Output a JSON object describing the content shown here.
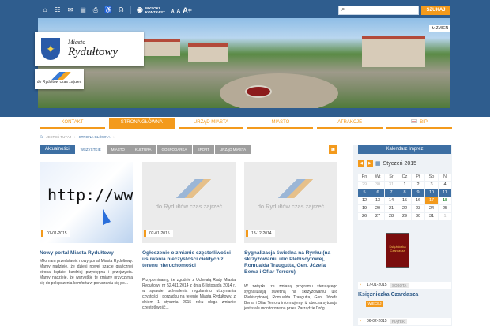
{
  "accessibility": {
    "contrast_line1": "WYSOKI",
    "contrast_line2": "KONTRAST",
    "font_small": "A",
    "font_medium": "A",
    "font_large": "A+"
  },
  "search": {
    "placeholder": "",
    "button": "SZUKAJ"
  },
  "header": {
    "change_label": "ZMIEŃ",
    "logo_top": "Miasto",
    "logo_name": "Rydułtowy",
    "badge_text": "do Rydułtów czas zajrzeć"
  },
  "nav": [
    "KONTAKT",
    "STRONA GŁÓWNA",
    "URZĄD MIASTA",
    "MIASTO",
    "ATRAKCJE",
    "BIP"
  ],
  "breadcrumb": {
    "label": "JESTEŚ TUTAJ",
    "current": "STRONA GŁÓWNA"
  },
  "news": {
    "tab_main": "Aktualności",
    "tabs": [
      "WSZYSTKIE",
      "MIASTO",
      "KULTURA",
      "GOSPODARKA",
      "SPORT",
      "URZĄD MIASTA"
    ],
    "items": [
      {
        "date": "01-01-2015",
        "image_text": "http://www.",
        "title": "Nowy portal Miasta Rydułtowy",
        "body": "Miło nam przedstawić nowy portal Miasta Rydułtowy. Mamy nadzieję, że dzięki nowej szacie graficznej strona będzie bardziej przystępna i przejrzysta. Mamy nadzieję, że wszystkie te zmiany przyczynią się do polepszenia komfortu w poruszaniu się po..."
      },
      {
        "date": "02-01-2015",
        "image_text": "do Rydułtów czas zajrzeć",
        "title": "Ogłoszenie o zmianie częstotliwości usuwania nieczystości ciekłych z terenu nieruchomości",
        "body": "Przypominamy, że zgodnie z Uchwałą Rady Miasta Rydułtowy nr 52.411.2014 z dnia 6 listopada 2014 r. w sprawie uchwalenia regulaminu utrzymania czystości i porządku na terenie Miasta Rydułtowy, z dniem 1 stycznia 2015 roku ulega zmianie częstotliwość..."
      },
      {
        "date": "18-12-2014",
        "image_text": "do Rydułtów czas zajrzeć",
        "title": "Sygnalizacja świetlna na Rynku (na skrzyżowaniu ulic Plebiscytowej, Romualda Traugutta, Gen. Józefa Bema i Ofiar Terroru)",
        "body": "W związku ze zmianą programu sterującego sygnalizacją świetlną na skrzyżowaniu ulic Plebiscytowej, Romualda Traugutta, Gen. Józefa Bema i Ofiar Terroru informujemy, iż obecna sytuacja jest stale monitorowana przez Zarządzie Dróg..."
      }
    ]
  },
  "calendar": {
    "title": "Kalendarz Imprez",
    "month": "Styczeń 2015",
    "days": [
      "Pn",
      "Wt",
      "Śr",
      "Cz",
      "Pt",
      "So",
      "N"
    ],
    "rows": [
      [
        "29",
        "30",
        "31",
        "1",
        "2",
        "3",
        "4"
      ],
      [
        "5",
        "6",
        "7",
        "8",
        "9",
        "10",
        "11"
      ],
      [
        "12",
        "13",
        "14",
        "15",
        "16",
        "17",
        "18"
      ],
      [
        "19",
        "20",
        "21",
        "22",
        "23",
        "24",
        "25"
      ],
      [
        "26",
        "27",
        "28",
        "29",
        "30",
        "31",
        "1"
      ]
    ]
  },
  "events": [
    {
      "date": "17-01-2015",
      "day": "SOBOTA",
      "title": "Księżniczka Czardasza",
      "tag": "WIĘCEJ"
    },
    {
      "date": "06-02-2015",
      "day": "PIĄTEK"
    }
  ],
  "poster_text": "Księżniczka Czardasza",
  "colors": {
    "primary": "#2f5d8e",
    "accent": "#f39a1c",
    "link": "#2d5a88"
  }
}
